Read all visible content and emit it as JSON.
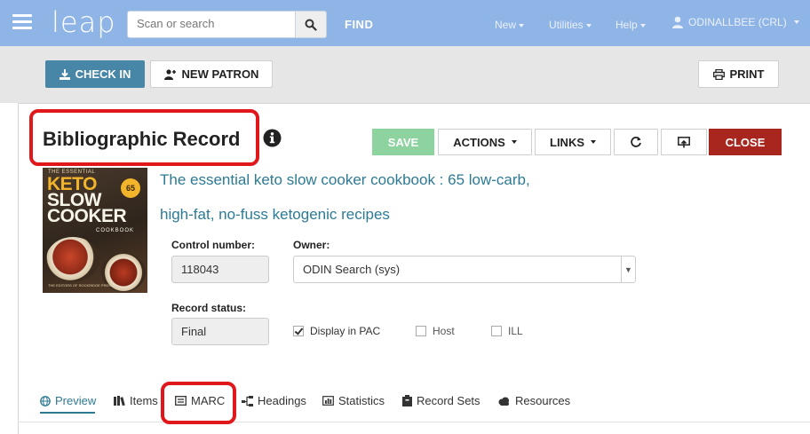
{
  "navbar": {
    "logo": "leap",
    "search_placeholder": "Scan or search",
    "find_label": "FIND",
    "menus": [
      "New",
      "Utilities",
      "Help"
    ],
    "user_label": "ODINALLBEE (CRL)"
  },
  "toolbar": {
    "checkin_label": "CHECK IN",
    "new_patron_label": "NEW PATRON",
    "print_label": "PRINT"
  },
  "record": {
    "title": "Bibliographic Record",
    "actions": {
      "save": "SAVE",
      "actions": "ACTIONS",
      "links": "LINKS",
      "close": "CLOSE"
    },
    "book_title": "The essential keto slow cooker cookbook : 65 low-carb, high-fat, no-fuss ketogenic recipes",
    "cover": {
      "line_small": "THE ESSENTIAL",
      "line1": "KETO",
      "line2": "SLOW",
      "line3": "COOKER",
      "line4": "COOKBOOK",
      "badge": "65",
      "author": "THE EDITORS OF ROCKRIDGE PRESS"
    },
    "control_number_label": "Control number:",
    "control_number": "118043",
    "owner_label": "Owner:",
    "owner": "ODIN Search (sys)",
    "record_status_label": "Record status:",
    "record_status": "Final",
    "checkboxes": [
      {
        "label": "Display in PAC",
        "checked": true
      },
      {
        "label": "Host",
        "checked": false
      },
      {
        "label": "ILL",
        "checked": false
      }
    ]
  },
  "tabs": [
    "Preview",
    "Items",
    "MARC",
    "Headings",
    "Statistics",
    "Record Sets",
    "Resources"
  ],
  "colors": {
    "navbar": "#8fb4e6",
    "accent": "#2d7a94",
    "save": "#8dd3a0",
    "close": "#a8261e",
    "highlight": "#e0181b"
  }
}
